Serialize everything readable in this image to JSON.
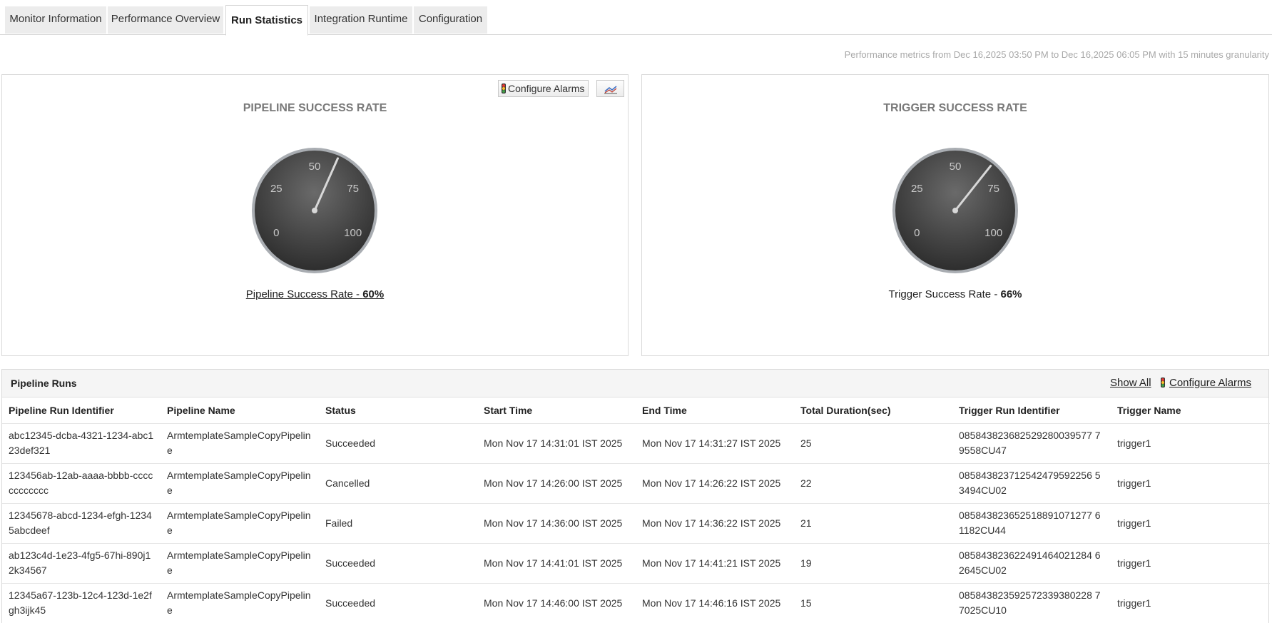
{
  "tabs": [
    {
      "label": "Monitor Information"
    },
    {
      "label": "Performance Overview"
    },
    {
      "label": "Run Statistics"
    },
    {
      "label": "Integration Runtime"
    },
    {
      "label": "Configuration"
    }
  ],
  "active_tab": "Run Statistics",
  "perf_note": "Performance metrics from Dec 16,2025 03:50 PM to Dec 16,2025 06:05 PM with 15 minutes granularity",
  "pipeline_gauge": {
    "title": "PIPELINE SUCCESS RATE",
    "caption_label": "Pipeline Success Rate - ",
    "caption_value": "60%",
    "value": 60,
    "ticks": [
      "0",
      "25",
      "50",
      "75",
      "100"
    ],
    "configure_alarms": "Configure Alarms"
  },
  "trigger_gauge": {
    "title": "TRIGGER SUCCESS RATE",
    "caption_label": "Trigger Success Rate - ",
    "caption_value": "66%",
    "value": 66,
    "ticks": [
      "0",
      "25",
      "50",
      "75",
      "100"
    ]
  },
  "runs": {
    "title": "Pipeline Runs",
    "show_all": "Show All",
    "configure_alarms": "Configure Alarms",
    "columns": [
      "Pipeline Run Identifier",
      "Pipeline Name",
      "Status",
      "Start Time",
      "End Time",
      "Total Duration(sec)",
      "Trigger Run Identifier",
      "Trigger Name"
    ],
    "rows": [
      [
        "abc12345-dcba-4321-1234-abc123def321",
        "ArmtemplateSampleCopyPipeline",
        "Succeeded",
        "Mon Nov 17 14:31:01 IST 2025",
        "Mon Nov 17 14:31:27 IST 2025",
        "25",
        "085843823682529280039577 79558CU47",
        "trigger1"
      ],
      [
        "123456ab-12ab-aaaa-bbbb-cccccccccccc",
        "ArmtemplateSampleCopyPipeline",
        "Cancelled",
        "Mon Nov 17 14:26:00 IST 2025",
        "Mon Nov 17 14:26:22 IST 2025",
        "22",
        "085843823712542479592256 53494CU02",
        "trigger1"
      ],
      [
        "12345678-abcd-1234-efgh-12345abcdeef",
        "ArmtemplateSampleCopyPipeline",
        "Failed",
        "Mon Nov 17 14:36:00 IST 2025",
        "Mon Nov 17 14:36:22 IST 2025",
        "21",
        "085843823652518891071277 61182CU44",
        "trigger1"
      ],
      [
        "ab123c4d-1e23-4fg5-67hi-890j12k34567",
        "ArmtemplateSampleCopyPipeline",
        "Succeeded",
        "Mon Nov 17 14:41:01 IST 2025",
        "Mon Nov 17 14:41:21 IST 2025",
        "19",
        "085843823622491464021284 62645CU02",
        "trigger1"
      ],
      [
        "12345a67-123b-12c4-123d-1e2fgh3ijk45",
        "ArmtemplateSampleCopyPipeline",
        "Succeeded",
        "Mon Nov 17 14:46:00 IST 2025",
        "Mon Nov 17 14:46:16 IST 2025",
        "15",
        "085843823592572339380228 77025CU10",
        "trigger1"
      ]
    ]
  }
}
